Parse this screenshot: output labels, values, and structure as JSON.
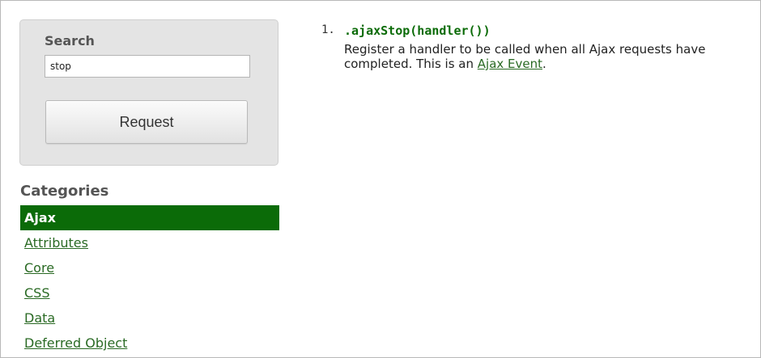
{
  "search": {
    "heading": "Search",
    "input_value": "stop",
    "button_label": "Request"
  },
  "categories": {
    "heading": "Categories",
    "items": [
      {
        "label": "Ajax",
        "active": true
      },
      {
        "label": "Attributes",
        "active": false
      },
      {
        "label": "Core",
        "active": false
      },
      {
        "label": "CSS",
        "active": false
      },
      {
        "label": "Data",
        "active": false
      },
      {
        "label": "Deferred Object",
        "active": false
      }
    ]
  },
  "results": [
    {
      "number": "1.",
      "title": ".ajaxStop(handler())",
      "desc_line1": "Register a handler to be called when all Ajax requests have",
      "desc_line2_prefix": "completed. This is an ",
      "desc_link": "Ajax Event",
      "desc_suffix": "."
    }
  ],
  "colors": {
    "accent_green": "#0b6b08",
    "link_green": "#2a6a24",
    "panel_gray": "#e4e4e4"
  }
}
